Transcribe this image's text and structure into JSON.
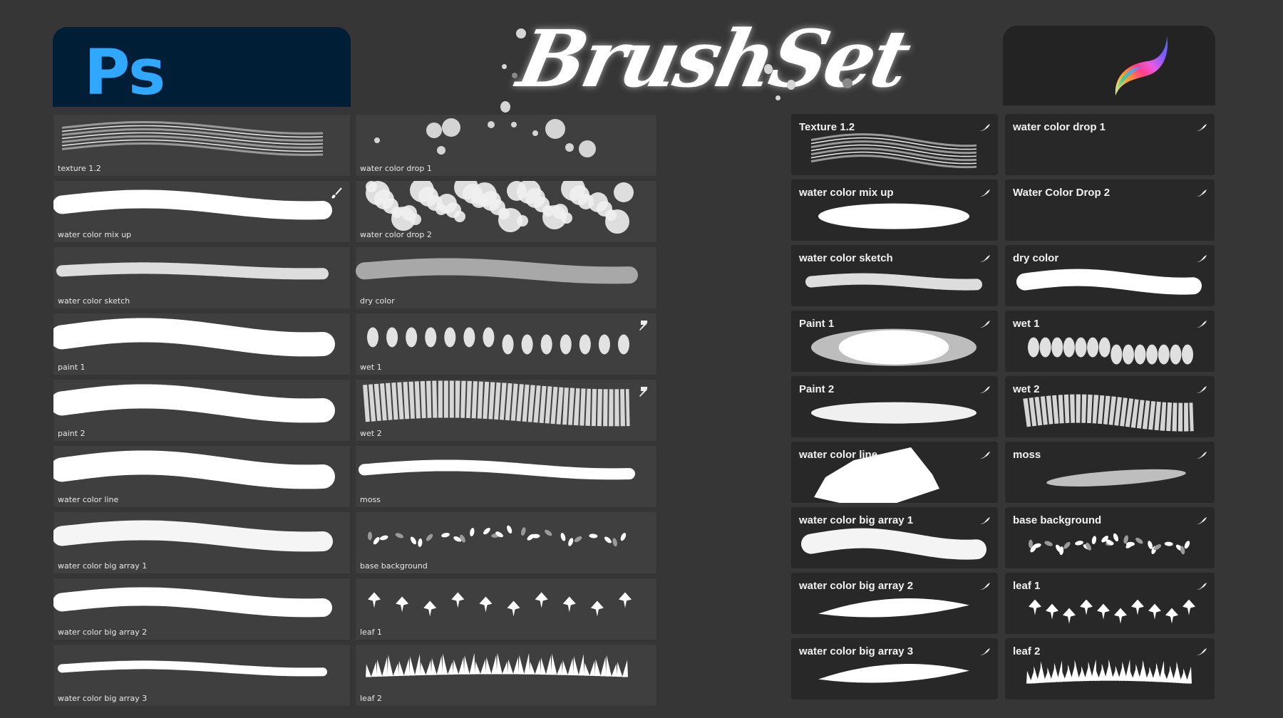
{
  "header": {
    "photoshop_logo": "Ps",
    "title": "BrushSet",
    "procreate_logo_icon": "procreate-feather-icon",
    "colors": {
      "background": "#363636",
      "ps_badge": "#001e36",
      "ps_text": "#31a8ff",
      "procreate_badge": "#232323"
    }
  },
  "photoshop": {
    "brushes": [
      {
        "name": "texture 1.2",
        "stroke": "lines",
        "icon": null
      },
      {
        "name": "water color drop 1",
        "stroke": "drops",
        "icon": null
      },
      {
        "name": "water color mix up",
        "stroke": "solid",
        "icon": "paintbrush-icon"
      },
      {
        "name": "water color drop 2",
        "stroke": "cloud",
        "icon": null
      },
      {
        "name": "water color sketch",
        "stroke": "speckle",
        "icon": null
      },
      {
        "name": "dry color",
        "stroke": "gray",
        "icon": null
      },
      {
        "name": "paint 1",
        "stroke": "rough",
        "icon": null
      },
      {
        "name": "wet 1",
        "stroke": "dabs",
        "icon": "smudge-icon"
      },
      {
        "name": "paint 2",
        "stroke": "rough",
        "icon": null
      },
      {
        "name": "wet 2",
        "stroke": "wetblock",
        "icon": "smudge-icon"
      },
      {
        "name": "water color line",
        "stroke": "rough",
        "icon": null
      },
      {
        "name": "moss",
        "stroke": "thin",
        "icon": null
      },
      {
        "name": "water color big array 1",
        "stroke": "soft",
        "icon": null
      },
      {
        "name": "base background",
        "stroke": "petals",
        "icon": null
      },
      {
        "name": "water color big array 2",
        "stroke": "solid",
        "icon": null
      },
      {
        "name": "leaf 1",
        "stroke": "leaves",
        "icon": null
      },
      {
        "name": "water color big array 3",
        "stroke": "thinsolid",
        "icon": null
      },
      {
        "name": "leaf 2",
        "stroke": "grass",
        "icon": null
      }
    ]
  },
  "procreate": {
    "brushes": [
      {
        "name": "Texture 1.2",
        "stroke": "lines"
      },
      {
        "name": "water color drop 1",
        "stroke": "none"
      },
      {
        "name": "water color mix up",
        "stroke": "blob"
      },
      {
        "name": "Water Color Drop 2",
        "stroke": "none"
      },
      {
        "name": "water color sketch",
        "stroke": "speckle"
      },
      {
        "name": "dry color",
        "stroke": "dry"
      },
      {
        "name": "Paint 1",
        "stroke": "paint"
      },
      {
        "name": "wet 1",
        "stroke": "dabs"
      },
      {
        "name": "Paint 2",
        "stroke": "taper"
      },
      {
        "name": "wet 2",
        "stroke": "wet"
      },
      {
        "name": "water color line",
        "stroke": "big"
      },
      {
        "name": "moss",
        "stroke": "moss"
      },
      {
        "name": "water color big array 1",
        "stroke": "soft"
      },
      {
        "name": "base background",
        "stroke": "petals"
      },
      {
        "name": "water color big array 2",
        "stroke": "sliver"
      },
      {
        "name": "leaf 1",
        "stroke": "leaves"
      },
      {
        "name": "water color big array 3",
        "stroke": "sliver"
      },
      {
        "name": "leaf 2",
        "stroke": "grass"
      }
    ]
  }
}
